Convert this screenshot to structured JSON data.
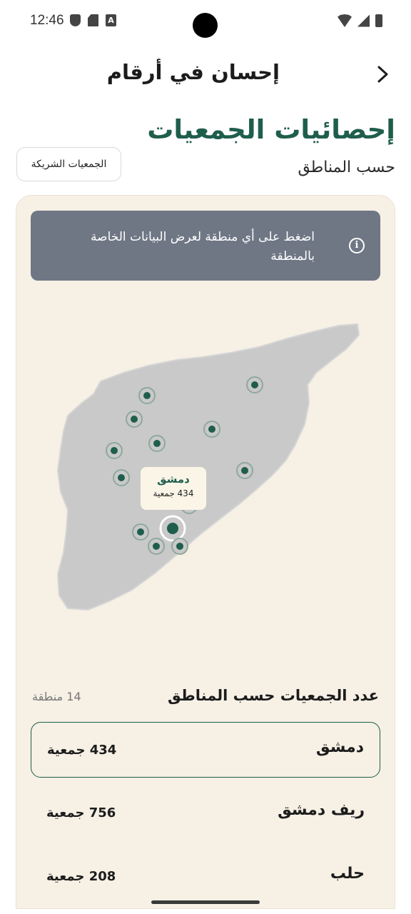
{
  "status_bar": {
    "time": "12:46"
  },
  "header": {
    "title": "إحسان في أرقام"
  },
  "section": {
    "title": "إحصائيات الجمعيات",
    "subtitle": "حسب المناطق",
    "partners_button": "الجمعيات الشريكة"
  },
  "info_banner": {
    "text": "اضغط على أي منطقة لعرض البيانات الخاصة بالمنطقة",
    "icon": "info-icon"
  },
  "map": {
    "selected_region": "دمشق",
    "tooltip_name": "دمشق",
    "tooltip_count": "434 جمعية",
    "colors": {
      "land": "#c9c9c9",
      "marker": "#1f5e4c",
      "marker_ring": "#8fa89d"
    }
  },
  "list": {
    "heading": "عدد الجمعيات حسب المناطق",
    "count_label": "14 منطقة",
    "regions": [
      {
        "name": "دمشق",
        "count": "434 جمعية",
        "selected": true
      },
      {
        "name": "ريف دمشق",
        "count": "756 جمعية",
        "selected": false
      },
      {
        "name": "حلب",
        "count": "208 جمعية",
        "selected": false
      }
    ]
  }
}
